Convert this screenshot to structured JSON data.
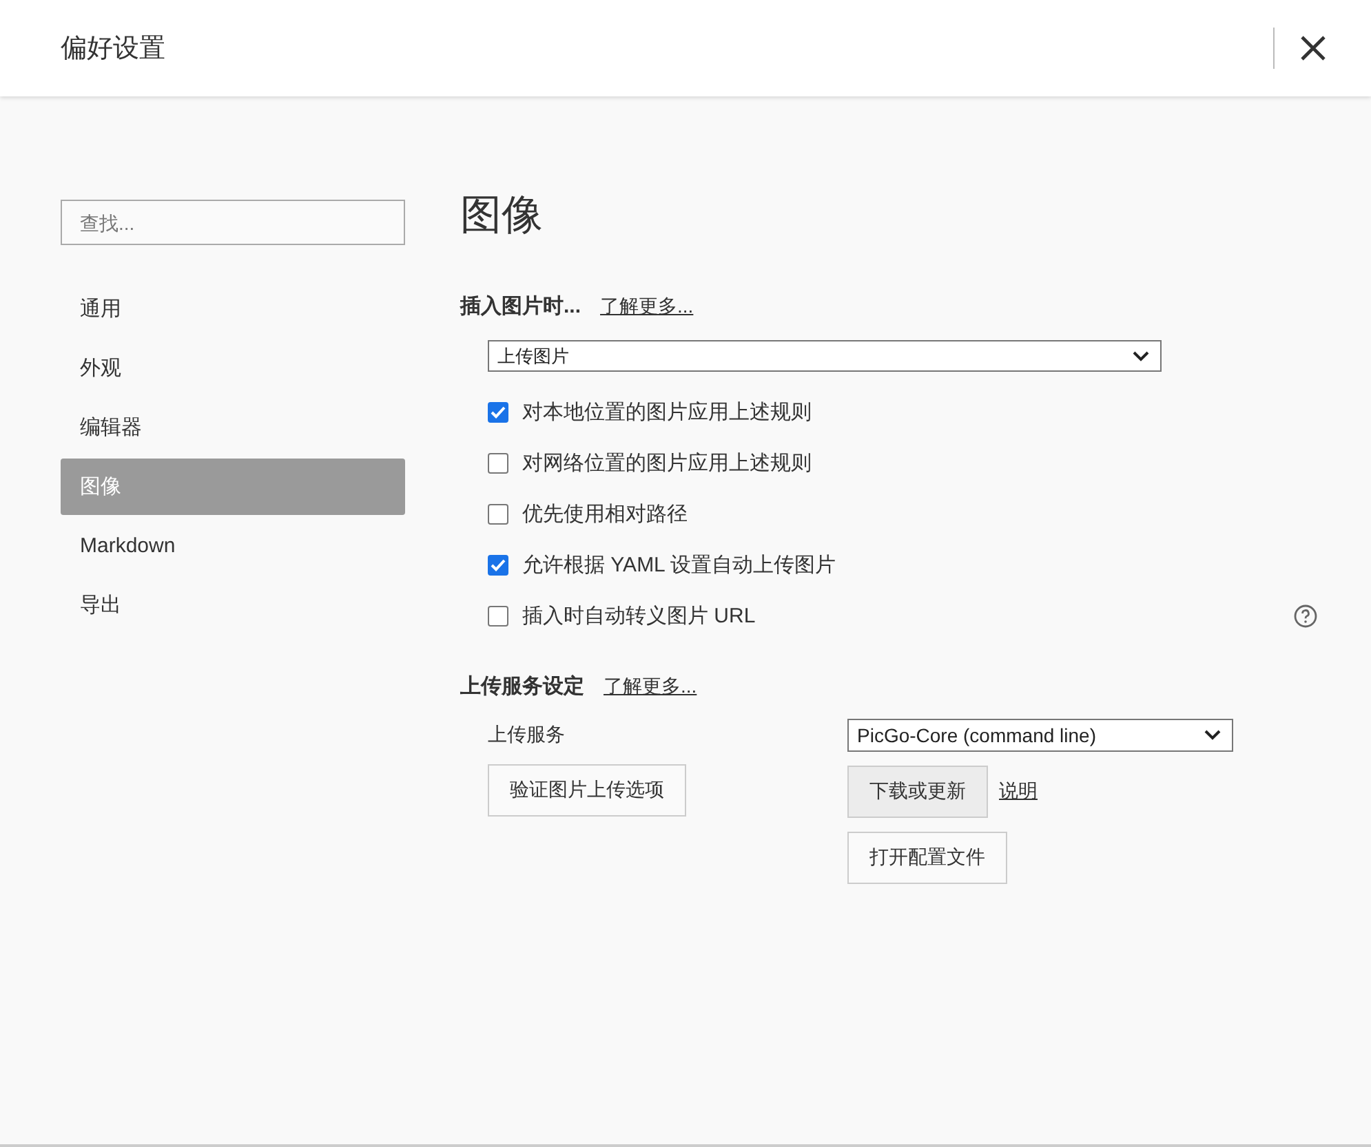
{
  "window": {
    "title": "偏好设置"
  },
  "sidebar": {
    "search": {
      "placeholder": "查找..."
    },
    "items": [
      {
        "label": "通用",
        "selected": false
      },
      {
        "label": "外观",
        "selected": false
      },
      {
        "label": "编辑器",
        "selected": false
      },
      {
        "label": "图像",
        "selected": true
      },
      {
        "label": "Markdown",
        "selected": false
      },
      {
        "label": "导出",
        "selected": false
      }
    ]
  },
  "page_title": "图像",
  "insert_section": {
    "heading": "插入图片时...",
    "link": "了解更多...",
    "dropdown": "上传图片",
    "options": [
      {
        "label": "对本地位置的图片应用上述规则",
        "checked": true
      },
      {
        "label": "对网络位置的图片应用上述规则",
        "checked": false
      },
      {
        "label": "优先使用相对路径",
        "checked": false
      },
      {
        "label": "允许根据 YAML 设置自动上传图片",
        "checked": true
      },
      {
        "label": "插入时自动转义图片 URL",
        "checked": false
      }
    ]
  },
  "upload_section": {
    "heading": "上传服务设定",
    "link": "了解更多...",
    "service_label": "上传服务",
    "service": "PicGo-Core (command line)",
    "verify_button": "验证图片上传选项",
    "download_button": {
      "label": "下载或更新",
      "highlighted": true
    },
    "help_link": "说明",
    "config_button": {
      "label": "打开配置文件",
      "highlighted": false
    }
  }
}
